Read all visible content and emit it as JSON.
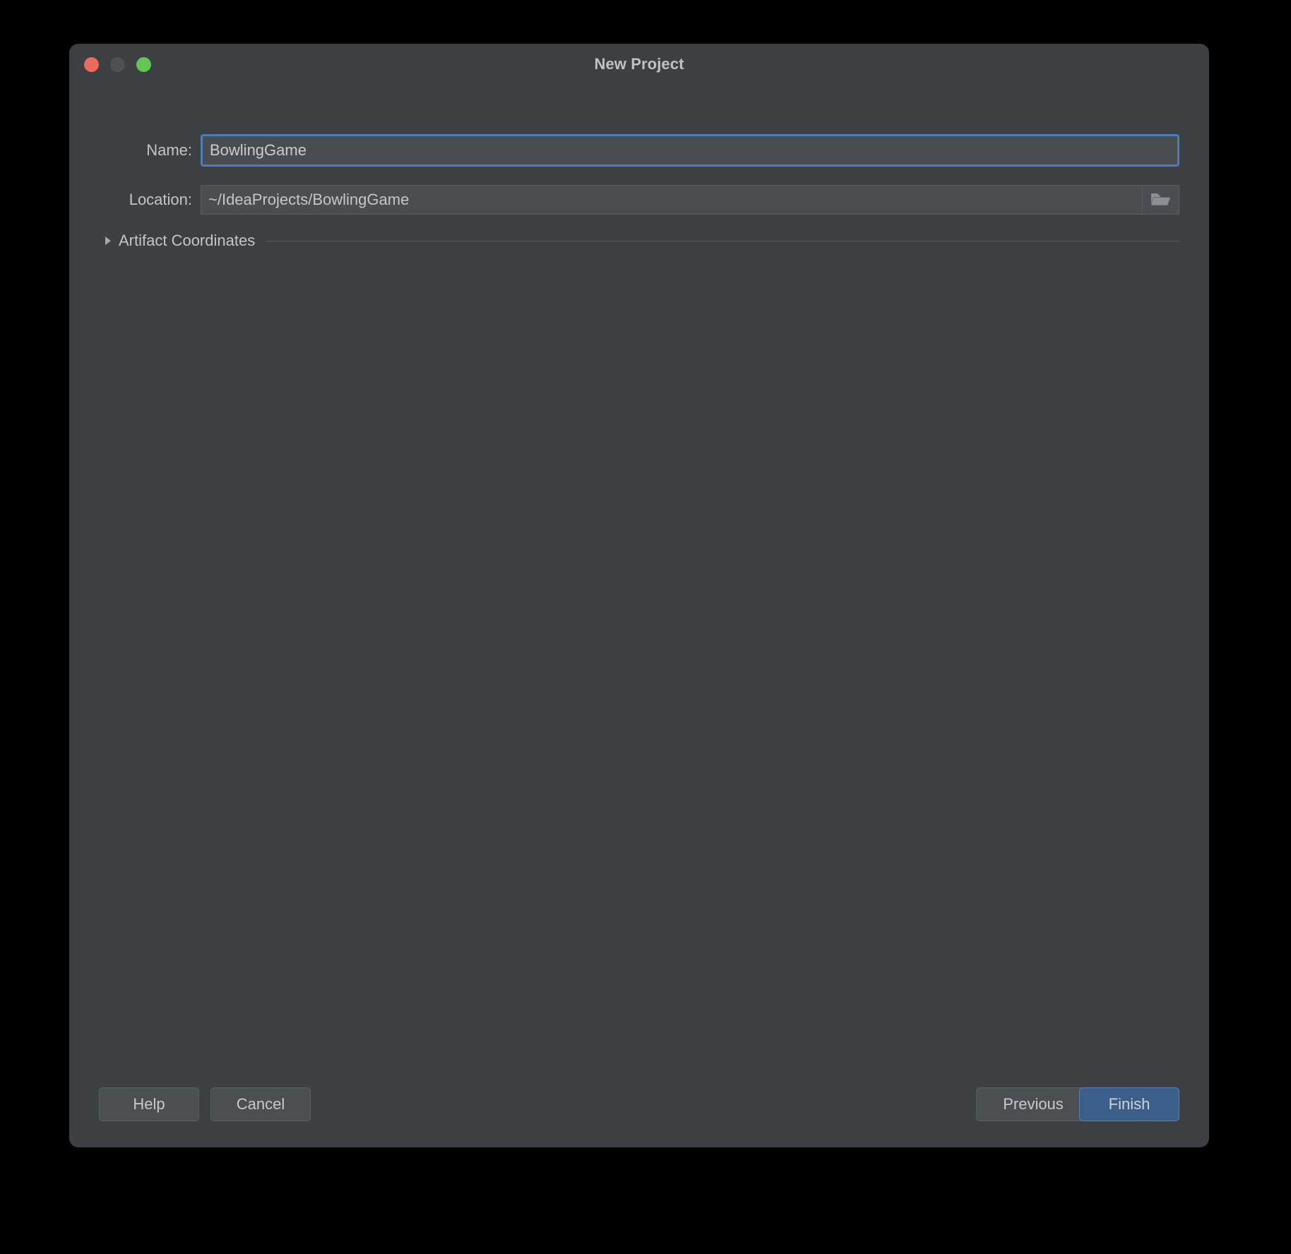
{
  "window": {
    "title": "New Project",
    "traffic_lights": [
      {
        "name": "close",
        "color": "#ea6a5e"
      },
      {
        "name": "minimize",
        "color": "#4d5154"
      },
      {
        "name": "maximize",
        "color": "#62c554"
      }
    ]
  },
  "form": {
    "name_field": {
      "label": "Name:",
      "value": "BowlingGame",
      "placeholder": "",
      "focused": true
    },
    "location_field": {
      "label": "Location:",
      "value": "~/IdeaProjects/BowlingGame",
      "placeholder": "",
      "browse_icon": "folder-open-icon"
    },
    "artifact_coordinates": {
      "label": "Artifact Coordinates",
      "expanded": false,
      "disclosure_icon": "chevron-right-icon"
    }
  },
  "footer": {
    "help_label": "Help",
    "cancel_label": "Cancel",
    "previous_label": "Previous",
    "finish_label": "Finish"
  },
  "colors": {
    "window_background": "#3c4043",
    "desktop_background": "#000000",
    "text_primary": "#c3c6c8",
    "title_text": "#bfc2c4",
    "focus_ring": "#4a7eb5",
    "accent_button": "#3c5f8a",
    "accent_button_border": "#5080b6",
    "field_background": "#4a4e51",
    "button_background": "#4b4f52",
    "separator": "#555a5d"
  }
}
